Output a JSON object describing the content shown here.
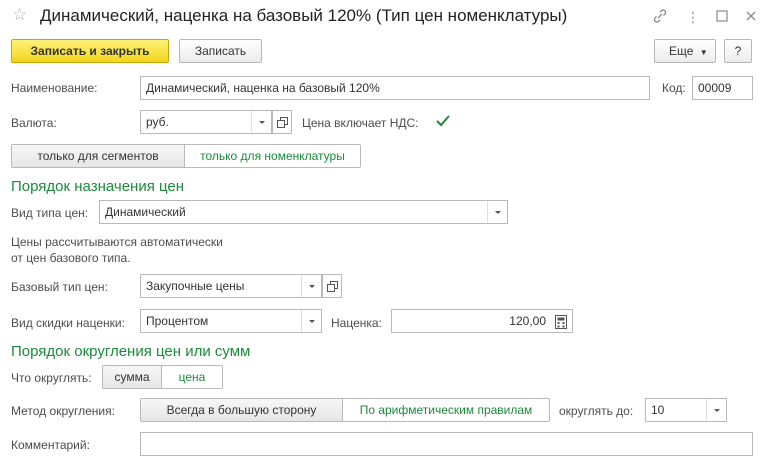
{
  "window": {
    "title": "Динамический, наценка на базовый 120% (Тип цен номенклатуры)"
  },
  "toolbar": {
    "save_close": "Записать и закрыть",
    "save": "Записать",
    "more": "Еще",
    "help": "?"
  },
  "name": {
    "label": "Наименование:",
    "value": "Динамический, наценка на базовый 120%"
  },
  "code": {
    "label": "Код:",
    "value": "00009"
  },
  "currency": {
    "label": "Валюта:",
    "value": "руб."
  },
  "vat": {
    "label": "Цена включает НДС:",
    "checked": true
  },
  "scope": {
    "options": [
      "только для сегментов",
      "только для номенклатуры"
    ],
    "selected": 1
  },
  "pricing": {
    "heading": "Порядок назначения цен",
    "type_label": "Вид типа цен:",
    "type_value": "Динамический",
    "note_line1": "Цены рассчитываются автоматически",
    "note_line2": "от цен базового типа.",
    "base_label": "Базовый тип цен:",
    "base_value": "Закупочные цены",
    "discount_label": "Вид скидки наценки:",
    "discount_value": "Процентом",
    "markup_label": "Наценка:",
    "markup_value": "120,00"
  },
  "rounding": {
    "heading": "Порядок округления цен или сумм",
    "what_label": "Что округлять:",
    "what_options": [
      "сумма",
      "цена"
    ],
    "what_selected": 1,
    "method_label": "Метод округления:",
    "method_options": [
      "Всегда в большую сторону",
      "По арифметическим правилам"
    ],
    "method_selected": 1,
    "to_label": "округлять до:",
    "to_value": "10"
  },
  "comment": {
    "label": "Комментарий:",
    "value": ""
  },
  "colors": {
    "accent": "#1c8a3b",
    "default_button": "#f5dc2a"
  }
}
